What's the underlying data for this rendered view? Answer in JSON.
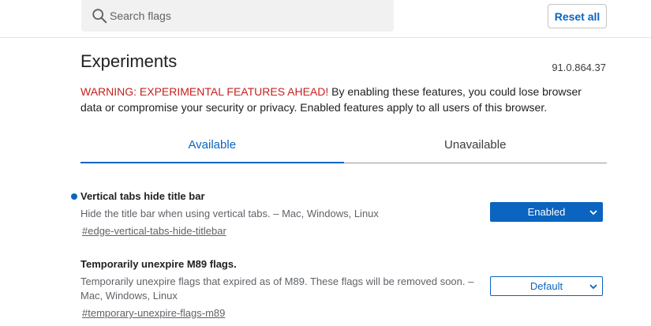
{
  "header": {
    "search_placeholder": "Search flags",
    "reset_label": "Reset all"
  },
  "page": {
    "title": "Experiments",
    "version": "91.0.864.37",
    "warning_strong": "WARNING: EXPERIMENTAL FEATURES AHEAD!",
    "warning_text": " By enabling these features, you could lose browser data or compromise your security or privacy. Enabled features apply to all users of this browser."
  },
  "tabs": [
    {
      "label": "Available",
      "active": true
    },
    {
      "label": "Unavailable",
      "active": false
    }
  ],
  "flags": [
    {
      "name": "Vertical tabs hide title bar",
      "description": "Hide the title bar when using vertical tabs. – Mac, Windows, Linux",
      "link": "#edge-vertical-tabs-hide-titlebar",
      "value": "Enabled",
      "modified": true
    },
    {
      "name": "Temporarily unexpire M89 flags.",
      "description": "Temporarily unexpire flags that expired as of M89. These flags will be removed soon. – Mac, Windows, Linux",
      "link": "#temporary-unexpire-flags-m89",
      "value": "Default",
      "modified": false
    }
  ],
  "colors": {
    "accent": "#0a64c0",
    "warning": "#c5221f"
  }
}
